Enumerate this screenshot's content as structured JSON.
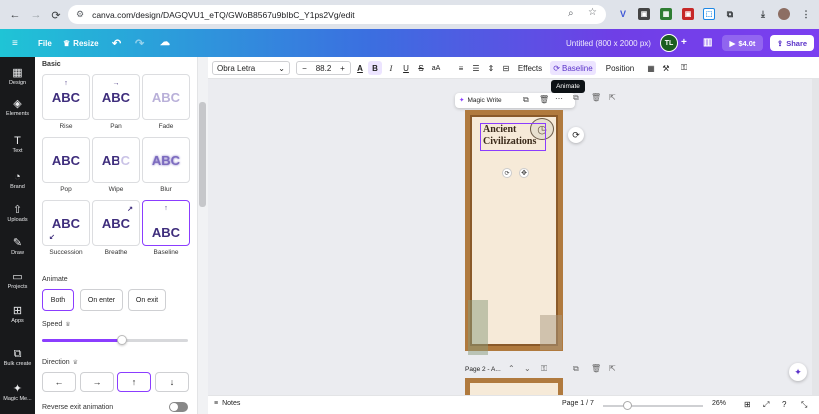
{
  "browser": {
    "url": "canva.com/design/DAGQVU1_eTQ/GWoB8567u9bIbC_Y1ps2Vg/edit"
  },
  "header": {
    "file_label": "File",
    "resize_label": "Resize",
    "doc_title": "Untitled (800 x 2000 px)",
    "avatar_initials": "TL",
    "present_label": "$4.0t",
    "share_label": "Share"
  },
  "rail": [
    {
      "label": "Design",
      "icon": "layout-icon"
    },
    {
      "label": "Elements",
      "icon": "shapes-icon"
    },
    {
      "label": "Text",
      "icon": "text-icon"
    },
    {
      "label": "Brand",
      "icon": "brand-icon"
    },
    {
      "label": "Uploads",
      "icon": "upload-icon"
    },
    {
      "label": "Draw",
      "icon": "draw-icon"
    },
    {
      "label": "Projects",
      "icon": "folder-icon"
    },
    {
      "label": "Apps",
      "icon": "apps-icon"
    },
    {
      "label": "Bulk create",
      "icon": "bulk-icon"
    },
    {
      "label": "Magic Me...",
      "icon": "magic-icon"
    }
  ],
  "panel": {
    "section_title": "Basic",
    "tile_text": "ABC",
    "animations": [
      "Rise",
      "Pan",
      "Fade",
      "Pop",
      "Wipe",
      "Blur",
      "Succession",
      "Breathe",
      "Baseline"
    ],
    "animate_title": "Animate",
    "animate_options": [
      "Both",
      "On enter",
      "On exit"
    ],
    "speed_label": "Speed",
    "speed_value": 0.55,
    "direction_label": "Direction",
    "directions": [
      "←",
      "→",
      "↑",
      "↓"
    ],
    "reverse_label": "Reverse exit animation"
  },
  "toolbar": {
    "font_name": "Obra Letra",
    "font_size": "88.2",
    "effects_label": "Effects",
    "baseline_label": "Baseline",
    "position_label": "Position",
    "tooltip": "Animate"
  },
  "canvas": {
    "magic_write_label": "Magic Write",
    "title_line1": "Ancient",
    "title_line2": "Civilizations",
    "page2_label": "Page 2 - A..."
  },
  "bottom": {
    "notes_label": "Notes",
    "page_indicator": "Page 1 / 7",
    "zoom": "26%"
  },
  "colors": {
    "accent": "#8b3dff",
    "paper": "#f6ead8",
    "frame": "#b07a3e"
  }
}
